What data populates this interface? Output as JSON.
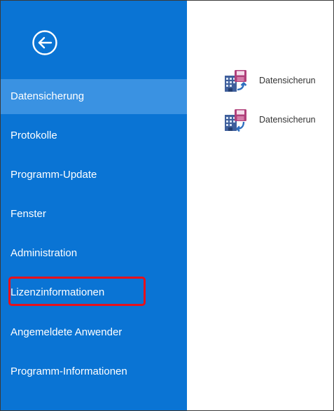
{
  "sidebar": {
    "back_icon": "back-arrow-circle-icon",
    "items": [
      {
        "label": "Datensicherung",
        "active": true
      },
      {
        "label": "Protokolle",
        "active": false
      },
      {
        "label": "Programm-Update",
        "active": false
      },
      {
        "label": "Fenster",
        "active": false
      },
      {
        "label": "Administration",
        "active": false
      },
      {
        "label": "Lizenzinformationen",
        "active": false,
        "highlighted": true
      },
      {
        "label": "Angemeldete Anwender",
        "active": false
      },
      {
        "label": "Programm-Informationen",
        "active": false
      }
    ]
  },
  "content": {
    "files": [
      {
        "label": "Datensicherun",
        "icon": "database-backup-icon"
      },
      {
        "label": "Datensicherun",
        "icon": "database-restore-icon"
      }
    ]
  },
  "colors": {
    "sidebar_bg": "#0a74d4",
    "active_item_bg": "#3a92e2",
    "highlight_border": "#e8101a",
    "disk_icon": "#b0407a"
  }
}
